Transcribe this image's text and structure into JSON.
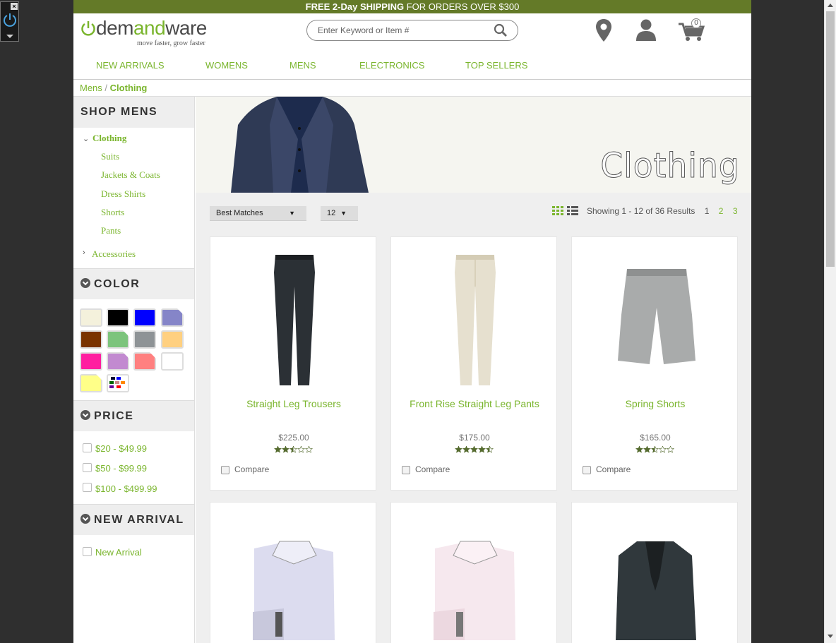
{
  "promo": {
    "part1": "FREE 2-Day SHIPPING",
    "part2": " FOR ORDERS OVER $300"
  },
  "logo": {
    "word_a": "dem",
    "word_b": "and",
    "word_c": "ware",
    "tagline": "move faster, grow faster"
  },
  "search": {
    "placeholder": "Enter Keyword or Item #"
  },
  "cart": {
    "count": "0"
  },
  "nav": [
    "NEW ARRIVALS",
    "WOMENS",
    "MENS",
    "ELECTRONICS",
    "TOP SELLERS"
  ],
  "breadcrumb": {
    "parent": "Mens",
    "separator": "/",
    "current": "Clothing"
  },
  "sidebar": {
    "shop_title": "SHOP MENS",
    "category": "Clothing",
    "subcategories": [
      "Suits",
      "Jackets & Coats",
      "Dress Shirts",
      "Shorts",
      "Pants"
    ],
    "other_category": "Accessories",
    "color_title": "COLOR",
    "colors": [
      "#f4f1dc",
      "#000000",
      "#0000ff",
      "#8585c8",
      "#7a3300",
      "#7cc47c",
      "#8e9396",
      "#ffd080",
      "#ff1fa0",
      "#c28ad0",
      "#ff8080",
      "#ffffff",
      "#ffff88",
      "multi"
    ],
    "price_title": "PRICE",
    "prices": [
      "$20 - $49.99",
      "$50 - $99.99",
      "$100 - $499.99"
    ],
    "arrival_title": "NEW ARRIVAL",
    "arrival_option": "New Arrival"
  },
  "banner": {
    "title": "Clothing"
  },
  "toolbar": {
    "sort": "Best Matches",
    "per_page": "12",
    "results_text": "Showing 1 - 12 of 36 Results",
    "pages": [
      "1",
      "2",
      "3"
    ]
  },
  "products": [
    {
      "name": "Straight Leg Trousers",
      "price": "$225.00",
      "rating": 2.5,
      "compare": "Compare"
    },
    {
      "name": "Front Rise Straight Leg Pants",
      "price": "$175.00",
      "rating": 4.5,
      "compare": "Compare"
    },
    {
      "name": "Spring Shorts",
      "price": "$165.00",
      "rating": 2.5,
      "compare": "Compare"
    }
  ],
  "colors": {
    "brand_green": "#7ab52d",
    "promo_bar": "#647a28"
  }
}
